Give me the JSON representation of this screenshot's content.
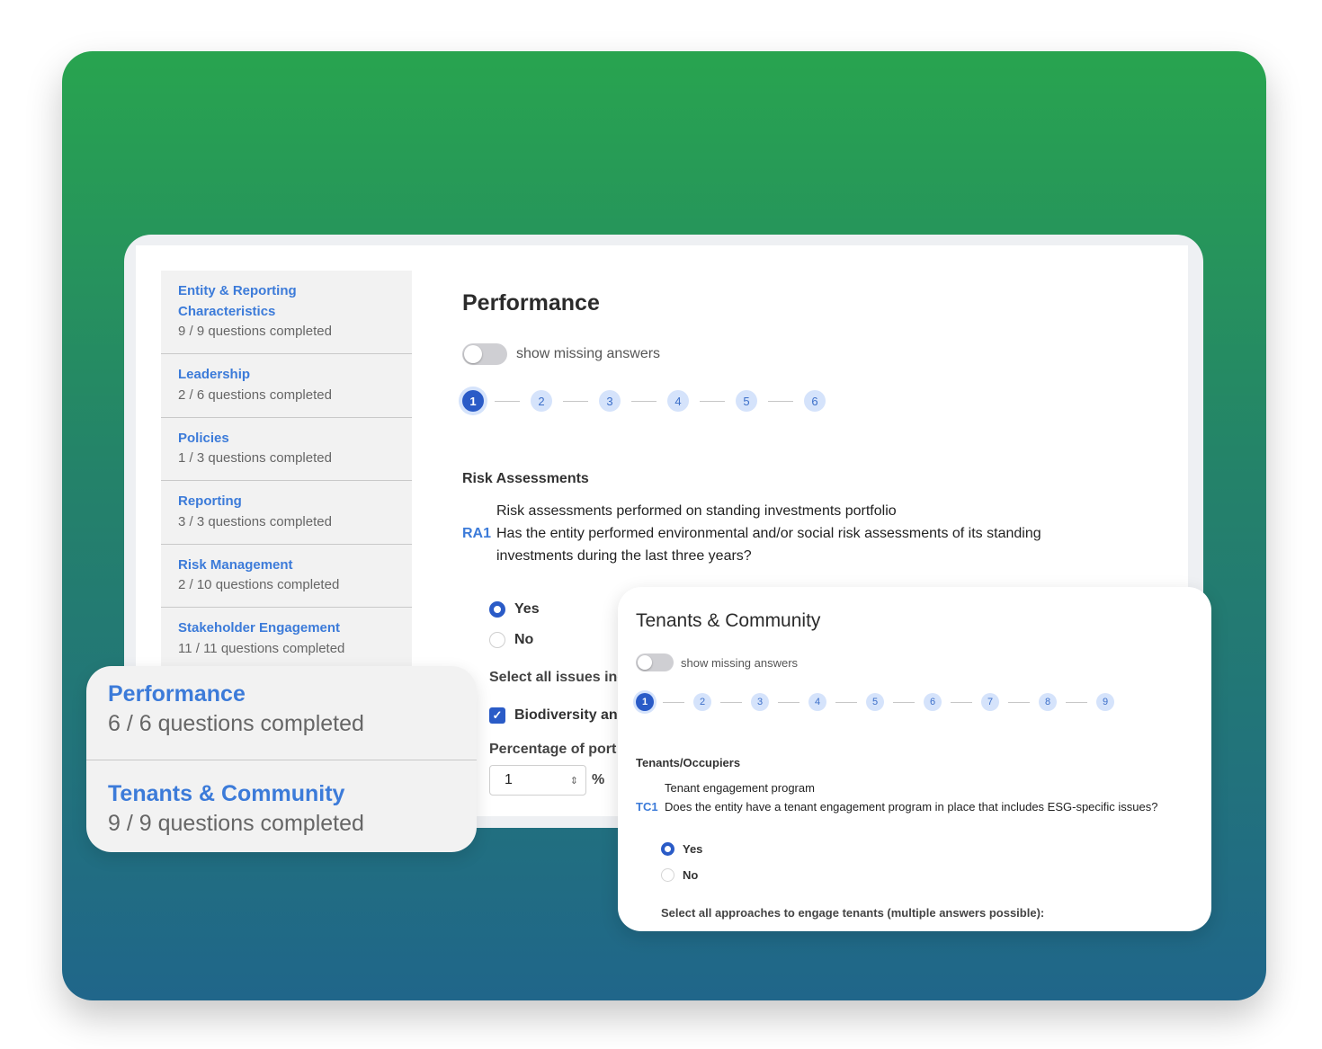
{
  "sidebar": {
    "items": [
      {
        "title": "Entity & Reporting Characteristics",
        "progress": "9 / 9 questions completed"
      },
      {
        "title": "Leadership",
        "progress": "2 / 6 questions completed"
      },
      {
        "title": "Policies",
        "progress": "1 / 3 questions completed"
      },
      {
        "title": "Reporting",
        "progress": "3 / 3 questions completed"
      },
      {
        "title": "Risk Management",
        "progress": "2 / 10 questions completed"
      },
      {
        "title": "Stakeholder Engagement",
        "progress": "11 / 11 questions completed"
      }
    ]
  },
  "performance": {
    "title": "Performance",
    "toggle_label": "show missing answers",
    "steps": [
      "1",
      "2",
      "3",
      "4",
      "5",
      "6"
    ],
    "active_step": 1,
    "section": "Risk Assessments",
    "question": {
      "code": "RA1",
      "subtitle": "Risk assessments performed on standing investments portfolio",
      "text": "Has the entity performed environmental and/or social risk assessments of its standing investments during the last three years?"
    },
    "options": [
      {
        "label": "Yes",
        "selected": true
      },
      {
        "label": "No",
        "selected": false
      }
    ],
    "select_label": "Select all issues inc",
    "checkbox_label": "Biodiversity anc",
    "percentage_label": "Percentage of port",
    "percentage_value": "1",
    "percent_sign": "%"
  },
  "summary_card": {
    "items": [
      {
        "title": "Performance",
        "progress": "6 / 6 questions completed"
      },
      {
        "title": "Tenants & Community",
        "progress": "9 / 9 questions completed"
      }
    ]
  },
  "tenants": {
    "title": "Tenants & Community",
    "toggle_label": "show missing answers",
    "steps": [
      "1",
      "2",
      "3",
      "4",
      "5",
      "6",
      "7",
      "8",
      "9"
    ],
    "active_step": 1,
    "section": "Tenants/Occupiers",
    "question": {
      "code": "TC1",
      "subtitle": "Tenant engagement program",
      "text": "Does the entity have a tenant engagement program in place that includes ESG-specific issues?"
    },
    "options": [
      {
        "label": "Yes",
        "selected": true
      },
      {
        "label": "No",
        "selected": false
      }
    ],
    "select_label": "Select all approaches to engage tenants (multiple answers possible):"
  },
  "colors": {
    "accent": "#3c7bd9",
    "active_step": "#2a5bc7",
    "gradient_top": "#28a44f",
    "gradient_bottom": "#20668a"
  }
}
